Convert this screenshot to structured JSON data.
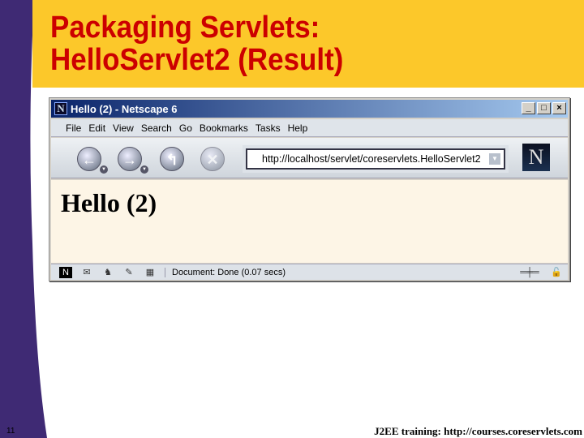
{
  "slide": {
    "title_line1": "Packaging Servlets:",
    "title_line2": "HelloServlet2 (Result)",
    "page_number": "11",
    "footer": "J2EE training: http://courses.coreservlets.com"
  },
  "browser": {
    "window_title": "Hello (2) - Netscape 6",
    "menu": [
      "File",
      "Edit",
      "View",
      "Search",
      "Go",
      "Bookmarks",
      "Tasks",
      "Help"
    ],
    "url": "http://localhost/servlet/coreservlets.HelloServlet2",
    "page_heading": "Hello (2)",
    "status": "Document: Done (0.07 secs)"
  },
  "colors": {
    "header": "#fcc82a",
    "title": "#cc0000",
    "band": "#3f2a74",
    "page_bg": "#fdf5e6"
  }
}
